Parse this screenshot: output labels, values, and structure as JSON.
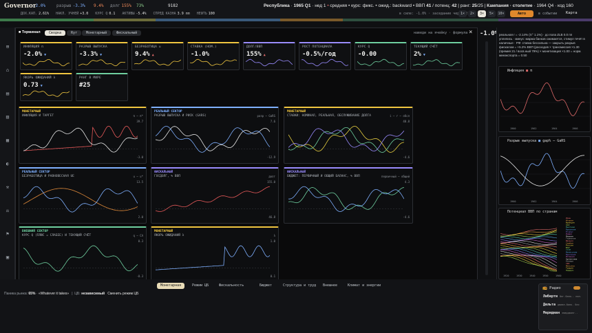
{
  "app": {
    "title": "Governor"
  },
  "top": {
    "stats": [
      {
        "icon": "diamond-icon",
        "label": "",
        "value": "-2.0%",
        "color": "#7fb0ff"
      },
      {
        "icon": "",
        "label": "разрыв",
        "value": "-3.3%",
        "color": "#7fb0ff"
      },
      {
        "icon": "",
        "label": "",
        "value": "9.4%",
        "color": "#f08a5a"
      },
      {
        "icon": "",
        "label": "долг",
        "value": "155%",
        "color": "#f08a5a"
      },
      {
        "icon": "",
        "label": "",
        "value": "73%",
        "color": "#8fd08f"
      },
      {
        "icon": "",
        "label": "",
        "value": "9182",
        "color": "#e6e6e6"
      }
    ],
    "row2": [
      {
        "label": "ДОХ.КАП.",
        "value": "2.61%"
      },
      {
        "label": "НАКЛ. УЧНЕЙ",
        "value": "+3.0"
      },
      {
        "label": "КУРС Q",
        "value": "0.1"
      },
      {
        "label": "АКТИВЫ",
        "value": "-5.4%"
      },
      {
        "label": "СПРЕД КАЗНА",
        "value": "3.9 пп"
      },
      {
        "label": "НЕФТЬ",
        "value": "100"
      }
    ],
    "status": {
      "republic": "Республика",
      "period": "1965 Q1",
      "period_suffix": "нед 1",
      "dot1": "•",
      "mode": "средняя",
      "rate": "курс: фикс.",
      "expect": "ожид.: backward",
      "gdp_label": "ВВП",
      "gdp_val": "41",
      "potential": "/ потенц:",
      "potential_val": "42",
      "rank": "ранг:",
      "rank_val": "25",
      "rank_total": "/25",
      "campaign": "Кампания · столетие",
      "campaign_years": "1964 Q4",
      "code": "код 160"
    },
    "controls": {
      "fiscal": "в силе: -1.0%",
      "meeting": "заседание через 2 нед",
      "speeds": [
        "1×",
        "2×",
        "3×",
        "5×",
        "10×"
      ],
      "auto": "Авто",
      "events": "в событии",
      "map": "Карта"
    }
  },
  "terminal": {
    "title": "Терминал",
    "tabs": [
      "Сводка",
      "Ryr",
      "Монетарный",
      "Фискальный"
    ],
    "hint": "наведи на ячейку · формула",
    "close": "×",
    "cards": [
      {
        "label": "ИНФЛЯЦИЯ π",
        "value": "-2.0%",
        "arrow": "▼",
        "color": "#f0c640"
      },
      {
        "label": "РАЗРЫВ ВЫПУСКА",
        "value": "-3.3%",
        "arrow": "▼",
        "color": "#f0c640"
      },
      {
        "label": "БЕЗРАБОТИЦА u",
        "value": "9.4%",
        "arrow": "▲",
        "color": "#f0c640"
      },
      {
        "label": "СТАВКА (НОМ.)",
        "value": "-1.0%",
        "arrow": "",
        "color": "#f0c640"
      },
      {
        "label": "ДОЛГ/ВВП",
        "value": "155%",
        "arrow": "▲",
        "color": "#9a8cff"
      },
      {
        "label": "РОСТ ПОТЕНЦИАЛА",
        "value": "-0.5%/год",
        "arrow": "",
        "color": "#9a8cff"
      },
      {
        "label": "КУРС Q",
        "value": "-0.00",
        "arrow": "",
        "color": "#6fd0a0"
      },
      {
        "label": "ТЕКУЩИЙ СЧЁТ",
        "value": "2%",
        "arrow": "▼",
        "color": "#6fd0a0"
      },
      {
        "label": "ЯКОРЬ ОЖИДАНИЙ λ",
        "value": "0.73",
        "arrow": "▼",
        "color": "#f0c640"
      },
      {
        "label": "РАНГ В МИРЕ",
        "value": "#25",
        "arrow": "",
        "color": "#6fd0a0"
      }
    ],
    "panels": [
      {
        "cat": "МОНЕТАРНЫЙ",
        "title": "ИНФЛЯЦИЯ И ТАРГЕТ",
        "legend": "π ─ π*",
        "color": "#f0c640",
        "top": "39.7",
        "bottom": "-3.0"
      },
      {
        "cat": "РЕАЛЬНЫЙ СЕКТОР",
        "title": "РАЗРЫВ ВЫПУСКА И РИСК (GARS)",
        "legend": "разр ─ GaRS",
        "color": "#7fb0ff",
        "top": "7.6",
        "bottom": "-12.9"
      },
      {
        "cat": "МОНЕТАРНЫЙ",
        "title": "СТАВКИ: НОМИНАЛ, РЕАЛЬНАЯ, ОБСЛУЖИВАНИЕ ДОЛГА",
        "legend": "i ─ r ─ обсл",
        "color": "#f0c640",
        "top": "48.8",
        "bottom": "-4.6"
      },
      {
        "cat": "РЕАЛЬНЫЙ СЕКТОР",
        "title": "БЕЗРАБОТИЦА И РАВНОВЕСНАЯ UE",
        "legend": "u ─ u*",
        "color": "#7fb0ff",
        "top": "13.5",
        "bottom": "2.0"
      },
      {
        "cat": "ФИСКАЛЬНЫЙ",
        "title": "ГОСДОЛГ, % ВВП",
        "legend": "долг",
        "color": "#9a8cff",
        "top": "155.0",
        "bottom": "46.8"
      },
      {
        "cat": "ФИСКАЛЬНЫЙ",
        "title": "БЮДЖЕТ: ПЕРВИЧНЫЙ И ОБЩИЙ БАЛАНС, % ВВП",
        "legend": "первичный ─ общий",
        "color": "#9a8cff",
        "top": "4.3",
        "bottom": "-4.6"
      },
      {
        "cat": "ВНЕШНИЙ СЕКТОР",
        "title": "КУРС Q (ПЛЮС = СЛАБЕЕ) И ТЕКУЩИЙ СЧЁТ",
        "legend": "q ─ CA",
        "color": "#6fd0a0",
        "top": "0.3",
        "bottom": "-0.3"
      },
      {
        "cat": "МОНЕТАРНЫЙ",
        "title": "ЯКОРЬ ОЖИДАНИЙ λ",
        "legend": "λ",
        "color": "#f0c640",
        "top": "1.0",
        "bottom": "0.1"
      }
    ]
  },
  "right": {
    "gauge": "-1.0%",
    "text1": "реальная r = -2.14% (π° 1.1%) · до пола ZLB 0.0 пп",
    "text2": "уплелись · минус: маржа банков сжимается, стимул течёт в наличные · РФ: ставка бессильна — закрыть разрыв фискалом = +5.2% ВВП (расходов × трансмиссия ×1.30 (премия 21 / восв.ный 79%) × монетизация ×1.00 = норм. минэкспорта = 0.50",
    "chart1": {
      "title": "Инфляция",
      "legend": "π",
      "years": [
        "1960",
        "1962",
        "1964",
        "1966"
      ]
    },
    "chart2": {
      "title": "Разрыв выпуска",
      "legend": "gap% ─ GaRS",
      "years": [
        "1960",
        "1962",
        "1964",
        "1966"
      ]
    },
    "chart3": {
      "title": "Потенциал ВВП по странам",
      "countries": [
        "Иран",
        "Италия",
        "Франция",
        "ОАЭ",
        "Вьетнам",
        "Бразилия",
        "Египет",
        "Индия",
        "Япония",
        "Германия",
        "Швеция",
        "Сербия",
        "Россия",
        "ЮАР",
        "СССР",
        "Венесуэла",
        "Британия",
        "Испания",
        "Аргентина",
        "Канада",
        "США",
        "Мексика",
        "Турция",
        "Нидерл."
      ],
      "years": [
        "1920",
        "1930",
        "1940",
        "1950",
        "1960"
      ]
    }
  },
  "bottom": {
    "tabs": [
      "Монетарная",
      "Режим ЦБ",
      "Фискальность",
      "Бюджет",
      "Структура и труд",
      "Внешнее",
      "Климат и энергии"
    ],
    "panic_label": "Паника рынка:",
    "panic_val": "65%",
    "whatever": "«Whatever it takes»",
    "cb_label": "ЦБ:",
    "cb_val": "независимый",
    "change": "Сменить режим ЦБ",
    "dock": {
      "title": "Радио",
      "items": [
        {
          "name": "Либерти",
          "sub": "бег.банк.. нал."
        },
        {
          "name": "Дельта",
          "sub": "джаве-банк. бес"
        },
        {
          "name": "Меридиан",
          "sub": "эмерджинг.."
        }
      ]
    }
  }
}
